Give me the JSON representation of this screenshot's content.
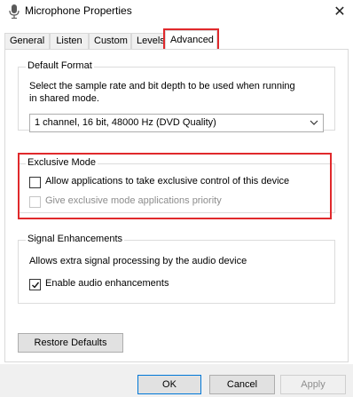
{
  "window": {
    "title": "Microphone Properties",
    "icon": "microphone-icon",
    "close_glyph": "✕"
  },
  "tabs": [
    {
      "label": "General",
      "active": false
    },
    {
      "label": "Listen",
      "active": false
    },
    {
      "label": "Custom",
      "active": false
    },
    {
      "label": "Levels",
      "active": false
    },
    {
      "label": "Advanced",
      "active": true
    }
  ],
  "default_format": {
    "legend": "Default Format",
    "description_line1": "Select the sample rate and bit depth to be used when running",
    "description_line2": "in shared mode.",
    "selected_value": "1 channel, 16 bit, 48000 Hz (DVD Quality)"
  },
  "exclusive_mode": {
    "legend": "Exclusive Mode",
    "allow_label": "Allow applications to take exclusive control of this device",
    "allow_checked": false,
    "priority_label": "Give exclusive mode applications priority",
    "priority_checked": false,
    "priority_enabled": false
  },
  "signal_enhancements": {
    "legend": "Signal Enhancements",
    "description": "Allows extra signal processing by the audio device",
    "enable_label": "Enable audio enhancements",
    "enable_checked": true
  },
  "buttons": {
    "restore_defaults": "Restore Defaults",
    "ok": "OK",
    "cancel": "Cancel",
    "apply": "Apply"
  },
  "colors": {
    "highlight": "#e0292c",
    "default_button_border": "#0078d7"
  }
}
